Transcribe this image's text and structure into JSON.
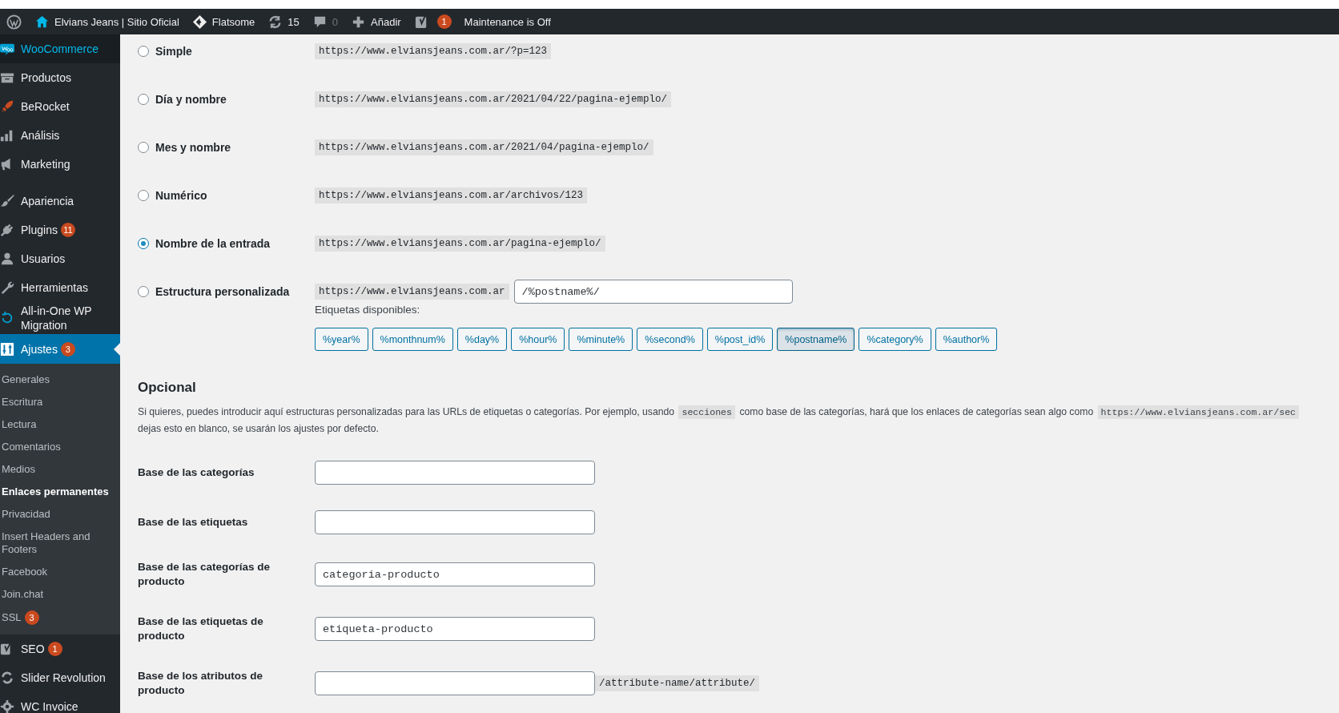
{
  "admin_bar": {
    "items": [
      {
        "label": "Elvians Jeans | Sitio Oficial"
      },
      {
        "label": "Flatsome"
      },
      {
        "label": "15"
      },
      {
        "label": "0",
        "dim": true
      },
      {
        "label": "Añadir"
      },
      {
        "badge": "1"
      },
      {
        "label": "Maintenance is Off"
      }
    ]
  },
  "sidebar": {
    "items": [
      {
        "label": "WooCommerce",
        "highlighted": true,
        "selected": false
      },
      {
        "label": "Productos",
        "selected": false
      },
      {
        "label": "BeRocket",
        "selected": false
      },
      {
        "label": "Análisis",
        "selected": false
      },
      {
        "label": "Marketing",
        "selected": false
      },
      {
        "label": "Apariencia",
        "gap_before": true,
        "selected": false
      },
      {
        "label": "Plugins",
        "badge": "11",
        "selected": false
      },
      {
        "label": "Usuarios",
        "selected": false
      },
      {
        "label": "Herramientas",
        "selected": false
      },
      {
        "label": "All-in-One WP Migration",
        "selected": false
      },
      {
        "label": "Ajustes",
        "badge": "3",
        "selected": true,
        "children": [
          {
            "label": "Generales",
            "selected": false
          },
          {
            "label": "Escritura",
            "selected": false
          },
          {
            "label": "Lectura",
            "selected": false
          },
          {
            "label": "Comentarios",
            "selected": false
          },
          {
            "label": "Medios",
            "selected": false
          },
          {
            "label": "Enlaces permanentes",
            "selected": true
          },
          {
            "label": "Privacidad",
            "selected": false
          },
          {
            "label": "Insert Headers and Footers",
            "selected": false
          },
          {
            "label": "Facebook",
            "selected": false
          },
          {
            "label": "Join.chat",
            "selected": false
          },
          {
            "label": "SSL",
            "badge": "3",
            "selected": false
          }
        ]
      },
      {
        "label": "SEO",
        "badge": "1",
        "selected": false
      },
      {
        "label": "Slider Revolution",
        "selected": false
      },
      {
        "label": "WC Invoice",
        "selected": false
      }
    ]
  },
  "permalink_options": [
    {
      "kind": "preset",
      "label": "Simple",
      "url": "https://www.elviansjeans.com.ar/?p=123",
      "selected": false
    },
    {
      "kind": "preset",
      "label": "Día y nombre",
      "url": "https://www.elviansjeans.com.ar/2021/04/22/pagina-ejemplo/",
      "selected": false
    },
    {
      "kind": "preset",
      "label": "Mes y nombre",
      "url": "https://www.elviansjeans.com.ar/2021/04/pagina-ejemplo/",
      "selected": false
    },
    {
      "kind": "preset",
      "label": "Numérico",
      "url": "https://www.elviansjeans.com.ar/archivos/123",
      "selected": false
    },
    {
      "kind": "preset",
      "label": "Nombre de la entrada",
      "url": "https://www.elviansjeans.com.ar/pagina-ejemplo/",
      "selected": true
    },
    {
      "kind": "custom",
      "label": "Estructura personalizada",
      "url": "https://www.elviansjeans.com.ar",
      "value": "/%postname%/",
      "selected": false
    }
  ],
  "available_tags": {
    "label": "Etiquetas disponibles:",
    "tags": [
      {
        "label": "%year%",
        "selected": false
      },
      {
        "label": "%monthnum%",
        "selected": false
      },
      {
        "label": "%day%",
        "selected": false
      },
      {
        "label": "%hour%",
        "selected": false
      },
      {
        "label": "%minute%",
        "selected": false
      },
      {
        "label": "%second%",
        "selected": false
      },
      {
        "label": "%post_id%",
        "selected": false
      },
      {
        "label": "%postname%",
        "selected": true
      },
      {
        "label": "%category%",
        "selected": false
      },
      {
        "label": "%author%",
        "selected": false
      }
    ]
  },
  "optional": {
    "heading": "Opcional",
    "description_lines": [
      [
        {
          "kind": "text",
          "text": "Si quieres, puedes introducir aquí estructuras personalizadas para las URLs de etiquetas o categorías. Por ejemplo, usando "
        },
        {
          "kind": "code",
          "text": "secciones"
        },
        {
          "kind": "text",
          "text": " como base de las categorías, hará que los enlaces de categorías sean algo como "
        },
        {
          "kind": "code",
          "text": "https://www.elviansjeans.com.ar/sec"
        }
      ],
      [
        {
          "kind": "text",
          "text": "dejas esto en blanco, se usarán los ajustes por defecto."
        }
      ]
    ],
    "fields": [
      {
        "label": "Base de las categorías"
      },
      {
        "label": "Base de las etiquetas"
      },
      {
        "label": "Base de las categorías de producto",
        "value": "categoria-producto"
      },
      {
        "label": "Base de las etiquetas de producto",
        "value": "etiqueta-producto"
      },
      {
        "label": "Base de los atributos de producto",
        "suffix": "/attribute-name/attribute/"
      }
    ]
  }
}
